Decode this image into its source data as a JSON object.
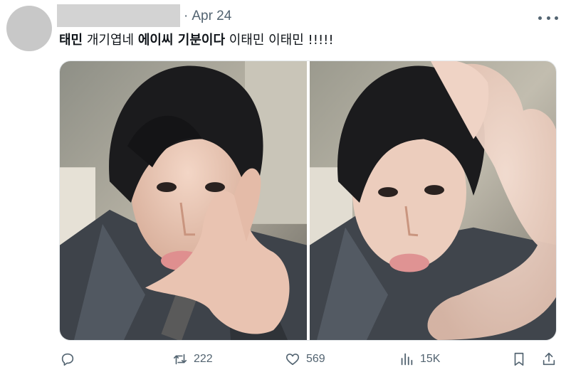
{
  "tweet": {
    "date": "Apr 24",
    "separator": "·",
    "text_parts": [
      {
        "text": "태민",
        "bold": true
      },
      {
        "text": " 개기엽네 ",
        "bold": false
      },
      {
        "text": "에이씨 기분이다",
        "bold": true
      },
      {
        "text": " 이태민 이태민 !!!!!",
        "bold": false
      }
    ]
  },
  "icons": {
    "more": "more-horizontal-icon",
    "reply": "reply-icon",
    "retweet": "retweet-icon",
    "like": "heart-icon",
    "views": "views-chart-icon",
    "bookmark": "bookmark-icon",
    "share": "share-icon"
  },
  "actions": {
    "reply_count": "",
    "retweet_count": "222",
    "like_count": "569",
    "view_count": "15K"
  },
  "colors": {
    "text": "#0f1419",
    "secondary": "#536471",
    "redaction": "#d3d3d3"
  }
}
